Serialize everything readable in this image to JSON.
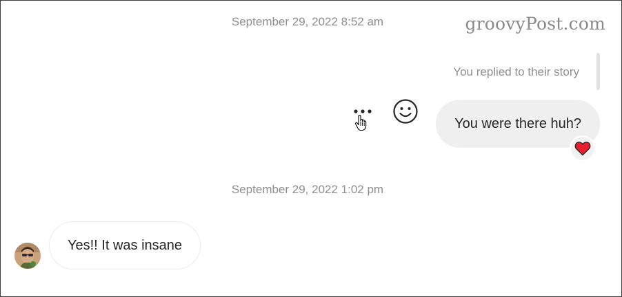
{
  "watermark": "groovyPost.com",
  "thread": {
    "timestamp_1": "September 29, 2022 8:52 am",
    "story_reply_note": "You replied to their story",
    "outgoing_message": "You were there huh?",
    "reaction": "heart-icon",
    "timestamp_2": "September 29, 2022 1:02 pm",
    "incoming_message": "Yes!! It was insane"
  },
  "icons": {
    "more": "more-options-icon",
    "emoji": "smiley-face-icon",
    "cursor": "hand-pointer-icon",
    "avatar": "user-avatar"
  },
  "colors": {
    "reaction_heart": "#e8202d",
    "outgoing_bubble": "#efefef",
    "timestamp_text": "#8e8e8e"
  }
}
